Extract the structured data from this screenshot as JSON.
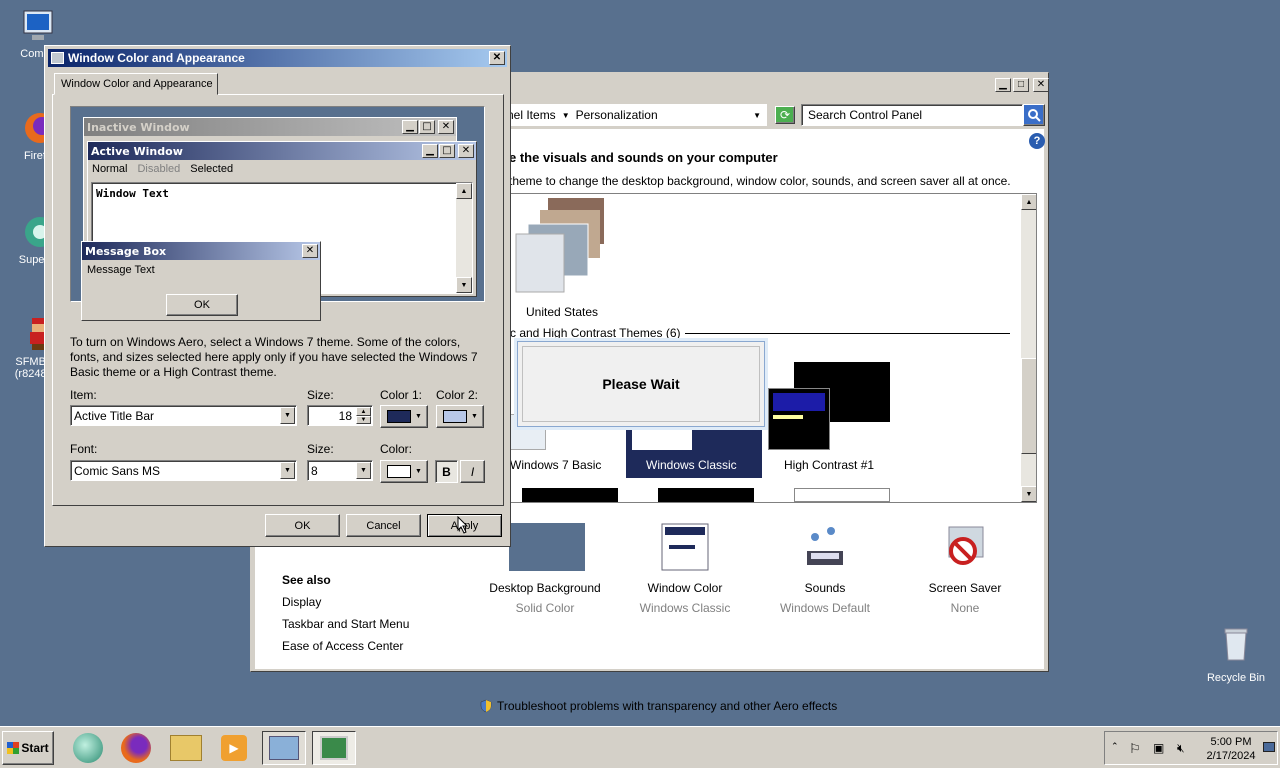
{
  "desktop": {
    "icons": [
      {
        "label": "Compu",
        "name": "computer"
      },
      {
        "label": "Firefo",
        "name": "firefox"
      },
      {
        "label": "Superm",
        "name": "supermium"
      },
      {
        "label": "SFMB v1",
        "sub": "(r8248) D",
        "name": "sfmb"
      },
      {
        "label": "Recycle Bin",
        "name": "recycle-bin"
      }
    ]
  },
  "control_panel": {
    "breadcrumb": [
      "nel Items",
      "Personalization"
    ],
    "search_placeholder": "Search Control Panel",
    "heading": "e the visuals and sounds on your computer",
    "subheading": "theme to change the desktop background, window color, sounds, and screen saver all at once.",
    "theme_united_states": "United States",
    "section_basic": "c and High Contrast Themes (6)",
    "themes": [
      "Windows 7 Basic",
      "Windows Classic",
      "High Contrast #1"
    ],
    "please_wait": "Please Wait",
    "bottom": [
      {
        "label": "Desktop Background",
        "sub": "Solid Color"
      },
      {
        "label": "Window Color",
        "sub": "Windows Classic"
      },
      {
        "label": "Sounds",
        "sub": "Windows Default"
      },
      {
        "label": "Screen Saver",
        "sub": "None"
      }
    ],
    "see_also": {
      "title": "See also",
      "links": [
        "Display",
        "Taskbar and Start Menu",
        "Ease of Access Center"
      ]
    },
    "troubleshoot": "Troubleshoot problems with transparency and other Aero effects"
  },
  "dialog": {
    "title": "Window Color and Appearance",
    "tab": "Window Color and Appearance",
    "preview": {
      "inactive": "Inactive Window",
      "active": "Active Window",
      "menu": [
        "Normal",
        "Disabled",
        "Selected"
      ],
      "window_text": "Window Text",
      "message_box": "Message Box",
      "message_text": "Message Text",
      "ok": "OK"
    },
    "info": "To turn on Windows Aero, select a Windows 7 theme.  Some of the colors, fonts, and sizes selected here apply only if you have selected the Windows 7 Basic theme or a High Contrast theme.",
    "item_label": "Item:",
    "item_value": "Active Title Bar",
    "size_label": "Size:",
    "size_value": "18",
    "color1_label": "Color 1:",
    "color2_label": "Color 2:",
    "font_label": "Font:",
    "font_value": "Comic Sans MS",
    "font_size_label": "Size:",
    "font_size_value": "8",
    "font_color_label": "Color:",
    "bold": "B",
    "italic": "I",
    "ok": "OK",
    "cancel": "Cancel",
    "apply": "Apply",
    "colors": {
      "color1": "#1e2a5a",
      "color2": "#b8c8e8",
      "font_color": "#ffffff"
    }
  },
  "taskbar": {
    "start": "Start",
    "time": "5:00 PM",
    "date": "2/17/2024"
  }
}
